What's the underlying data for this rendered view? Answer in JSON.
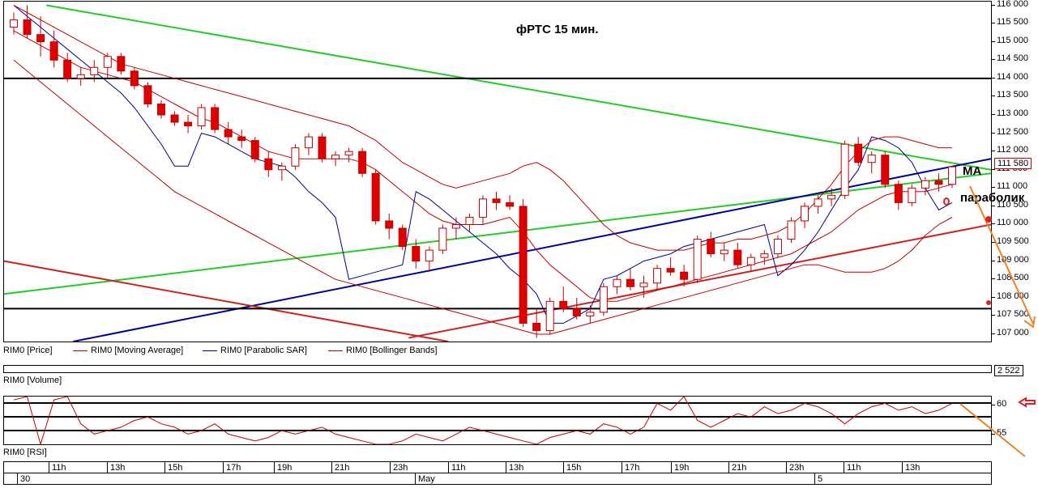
{
  "chart_data": {
    "type": "candlestick",
    "title": "фРТС   15 мин.",
    "instrument": "RIM0",
    "price_axis": {
      "ticks": [
        "116 000",
        "115 500",
        "115 000",
        "114 500",
        "114 000",
        "113 500",
        "113 000",
        "112 500",
        "112 000",
        "111 500",
        "111 000",
        "110 500",
        "110 000",
        "109 500",
        "109 000",
        "108 500",
        "108 000",
        "107 500",
        "107 000"
      ],
      "ylim": [
        106800,
        116100
      ]
    },
    "last_price": "111 580",
    "last_volume": "2 522",
    "legend": [
      {
        "label": "RIM0 [Price]",
        "color": "#000000"
      },
      {
        "label": "RIM0 [Moving Average]",
        "color": "#c00000"
      },
      {
        "label": "RIM0 [Parabolic SAR]",
        "color": "#00008b"
      },
      {
        "label": "RIM0 [Bollinger Bands]",
        "color": "#c00000"
      }
    ],
    "volume_pane_label": "RIM0 [Volume]",
    "rsi_pane_label": "RIM0 [RSI]",
    "rsi_ticks": [
      "60",
      "55"
    ],
    "annotations": [
      "MA",
      "параболик"
    ],
    "time_axis": {
      "hours": [
        "11h",
        "13h",
        "15h",
        "17h",
        "19h",
        "21h",
        "23h",
        "11h",
        "13h",
        "15h",
        "17h",
        "19h",
        "21h",
        "23h",
        "11h",
        "13h"
      ],
      "dates": [
        "30",
        "May",
        "5"
      ]
    },
    "candles": [
      [
        115400,
        115800,
        115200,
        115600
      ],
      [
        115600,
        116000,
        115100,
        115200
      ],
      [
        115200,
        115700,
        114600,
        115000
      ],
      [
        115000,
        115300,
        114300,
        114500
      ],
      [
        114500,
        114700,
        113900,
        114000
      ],
      [
        114000,
        114300,
        113800,
        114100
      ],
      [
        114100,
        114500,
        113900,
        114300
      ],
      [
        114300,
        114700,
        114000,
        114600
      ],
      [
        114600,
        114700,
        114100,
        114200
      ],
      [
        114200,
        114300,
        113700,
        113800
      ],
      [
        113800,
        113900,
        113200,
        113300
      ],
      [
        113300,
        113400,
        112900,
        113000
      ],
      [
        113000,
        113100,
        112700,
        112800
      ],
      [
        112800,
        113000,
        112500,
        112700
      ],
      [
        112700,
        113300,
        112600,
        113200
      ],
      [
        113200,
        113300,
        112500,
        112600
      ],
      [
        112600,
        112800,
        112200,
        112400
      ],
      [
        112400,
        112600,
        112100,
        112300
      ],
      [
        112300,
        112400,
        111700,
        111800
      ],
      [
        111800,
        112000,
        111300,
        111500
      ],
      [
        111500,
        111700,
        111200,
        111600
      ],
      [
        111600,
        112200,
        111500,
        112100
      ],
      [
        112100,
        112500,
        111900,
        112400
      ],
      [
        112400,
        112500,
        111700,
        111800
      ],
      [
        111800,
        112000,
        111600,
        111900
      ],
      [
        111900,
        112100,
        111700,
        112000
      ],
      [
        112000,
        112100,
        111300,
        111400
      ],
      [
        111400,
        111500,
        110000,
        110100
      ],
      [
        110100,
        110300,
        109600,
        109900
      ],
      [
        109900,
        110000,
        109300,
        109400
      ],
      [
        109400,
        109600,
        108800,
        109000
      ],
      [
        109000,
        109400,
        108700,
        109300
      ],
      [
        109300,
        110000,
        109200,
        109900
      ],
      [
        109900,
        110200,
        109600,
        110000
      ],
      [
        110000,
        110300,
        109800,
        110200
      ],
      [
        110200,
        110800,
        110000,
        110700
      ],
      [
        110700,
        110900,
        110400,
        110600
      ],
      [
        110600,
        110800,
        110400,
        110500
      ],
      [
        110500,
        110700,
        107200,
        107300
      ],
      [
        107300,
        107700,
        106900,
        107100
      ],
      [
        107100,
        108000,
        107000,
        107900
      ],
      [
        107900,
        108300,
        107600,
        107700
      ],
      [
        107700,
        108000,
        107400,
        107500
      ],
      [
        107500,
        107800,
        107300,
        107600
      ],
      [
        107600,
        108400,
        107500,
        108300
      ],
      [
        108300,
        108600,
        108100,
        108500
      ],
      [
        108500,
        108800,
        108200,
        108300
      ],
      [
        108300,
        108600,
        108000,
        108400
      ],
      [
        108400,
        108900,
        108200,
        108800
      ],
      [
        108800,
        109100,
        108600,
        108700
      ],
      [
        108700,
        108900,
        108300,
        108500
      ],
      [
        108500,
        109700,
        108400,
        109600
      ],
      [
        109600,
        109800,
        109100,
        109200
      ],
      [
        109200,
        109500,
        109000,
        109300
      ],
      [
        109300,
        109500,
        108800,
        108900
      ],
      [
        108900,
        109200,
        108700,
        109100
      ],
      [
        109100,
        109300,
        108900,
        109200
      ],
      [
        109200,
        109700,
        109100,
        109600
      ],
      [
        109600,
        110200,
        109500,
        110100
      ],
      [
        110100,
        110600,
        109900,
        110500
      ],
      [
        110500,
        110800,
        110300,
        110700
      ],
      [
        110700,
        111000,
        110500,
        110800
      ],
      [
        110800,
        112300,
        110700,
        112200
      ],
      [
        112200,
        112400,
        111600,
        111700
      ],
      [
        111700,
        112000,
        111400,
        111900
      ],
      [
        111900,
        112000,
        111000,
        111100
      ],
      [
        111100,
        111200,
        110400,
        110600
      ],
      [
        110600,
        111100,
        110500,
        111000
      ],
      [
        111000,
        111300,
        110800,
        111200
      ],
      [
        111200,
        111400,
        110900,
        111100
      ],
      [
        111100,
        111600,
        111000,
        111580
      ]
    ],
    "series": [
      {
        "name": "RIM0 [Moving Average]",
        "values": [
          115300,
          115100,
          114900,
          114700,
          114500,
          114300,
          114200,
          114100,
          114000,
          113900,
          113700,
          113500,
          113300,
          113100,
          112900,
          112800,
          112600,
          112400,
          112200,
          112000,
          111900,
          111800,
          111800,
          111800,
          111800,
          111800,
          111700,
          111500,
          111200,
          110900,
          110600,
          110300,
          110100,
          110000,
          110000,
          110000,
          110100,
          110200,
          109800,
          109300,
          108900,
          108600,
          108300,
          108000,
          107900,
          107900,
          108000,
          108100,
          108200,
          108300,
          108400,
          108500,
          108600,
          108700,
          108800,
          108900,
          109000,
          109100,
          109200,
          109400,
          109600,
          109800,
          110100,
          110400,
          110600,
          110800,
          110900,
          110900,
          110900,
          111000,
          111100
        ]
      },
      {
        "name": "RIM0 [Parabolic SAR]",
        "values": [
          116000,
          115700,
          115400,
          115100,
          114800,
          114500,
          114200,
          113900,
          113600,
          113200,
          112700,
          112200,
          111600,
          111600,
          112500,
          112400,
          112200,
          112000,
          111800,
          111700,
          111600,
          111300,
          110900,
          110600,
          110200,
          108500,
          108600,
          108700,
          108800,
          108900,
          110900,
          110700,
          110400,
          110100,
          109800,
          109500,
          109200,
          108800,
          108500,
          108100,
          107300,
          107300,
          107500,
          107700,
          108500,
          108600,
          108800,
          109000,
          109100,
          109200,
          109400,
          109500,
          109600,
          109700,
          109800,
          109900,
          110000,
          108600,
          108900,
          109300,
          109800,
          110400,
          111000,
          111500,
          112400,
          112300,
          112100,
          111700,
          111000,
          110400,
          110600
        ]
      },
      {
        "name": "RIM0 [Bollinger Bands] upper",
        "values": [
          116000,
          115800,
          115600,
          115400,
          115200,
          115000,
          114800,
          114600,
          114400,
          114300,
          114200,
          114100,
          114000,
          113900,
          113800,
          113700,
          113600,
          113500,
          113400,
          113300,
          113200,
          113100,
          113000,
          112900,
          112800,
          112700,
          112500,
          112300,
          112000,
          111700,
          111500,
          111300,
          111100,
          111000,
          111100,
          111200,
          111300,
          111400,
          111600,
          111700,
          111500,
          111200,
          110800,
          110400,
          110000,
          109700,
          109500,
          109400,
          109300,
          109300,
          109300,
          109400,
          109500,
          109500,
          109600,
          109600,
          109700,
          109800,
          110000,
          110300,
          110700,
          111100,
          111600,
          112000,
          112300,
          112400,
          112400,
          112300,
          112200,
          112100,
          112100
        ]
      },
      {
        "name": "RIM0 [Bollinger Bands] lower",
        "values": [
          114500,
          114200,
          113900,
          113600,
          113300,
          113000,
          112700,
          112400,
          112100,
          111800,
          111500,
          111200,
          110900,
          110700,
          110500,
          110300,
          110100,
          109900,
          109700,
          109500,
          109300,
          109100,
          108900,
          108700,
          108500,
          108400,
          108300,
          108200,
          108100,
          108000,
          107900,
          107800,
          107700,
          107600,
          107500,
          107400,
          107300,
          107200,
          107100,
          107000,
          107000,
          107100,
          107200,
          107300,
          107400,
          107500,
          107600,
          107700,
          107800,
          107900,
          108000,
          108100,
          108200,
          108300,
          108400,
          108500,
          108600,
          108700,
          108800,
          108900,
          108900,
          108800,
          108700,
          108700,
          108700,
          108800,
          109000,
          109300,
          109700,
          110000,
          110200
        ]
      }
    ],
    "trendlines": [
      {
        "color": "#22cc22",
        "from": [
          0,
          108100
        ],
        "to": [
          1,
          111400
        ]
      },
      {
        "color": "#22cc22",
        "from": [
          0.043,
          116000
        ],
        "to": [
          1,
          111500
        ]
      },
      {
        "color": "#000099",
        "from": [
          0.07,
          106800
        ],
        "to": [
          1,
          111800
        ]
      },
      {
        "color": "#cc2222",
        "from": [
          0,
          109000
        ],
        "to": [
          0.45,
          106800
        ]
      },
      {
        "color": "#cc2222",
        "from": [
          0.41,
          106900
        ],
        "to": [
          1,
          110000
        ]
      },
      {
        "color": "#000000",
        "from": [
          0,
          114000
        ],
        "to": [
          1,
          114000
        ]
      },
      {
        "color": "#000000",
        "from": [
          0,
          107700
        ],
        "to": [
          1,
          107700
        ]
      }
    ],
    "rsi_values": [
      62,
      63,
      48,
      62,
      63,
      55,
      52,
      53,
      54,
      56,
      57,
      55,
      54,
      52,
      53,
      55,
      52,
      51,
      50,
      51,
      53,
      52,
      53,
      54,
      52,
      51,
      50,
      49,
      48,
      50,
      52,
      51,
      50,
      52,
      54,
      53,
      52,
      51,
      50,
      49,
      51,
      52,
      53,
      52,
      55,
      54,
      52,
      54,
      61,
      59,
      63,
      56,
      54,
      56,
      58,
      57,
      60,
      58,
      59,
      61,
      60,
      58,
      55,
      58,
      60,
      61,
      59,
      60,
      58,
      59,
      61
    ]
  },
  "colors": {
    "accent_red": "#c00000",
    "orange_arrow": "#f08020",
    "green_line": "#22cc22",
    "blue_line": "#000099"
  }
}
